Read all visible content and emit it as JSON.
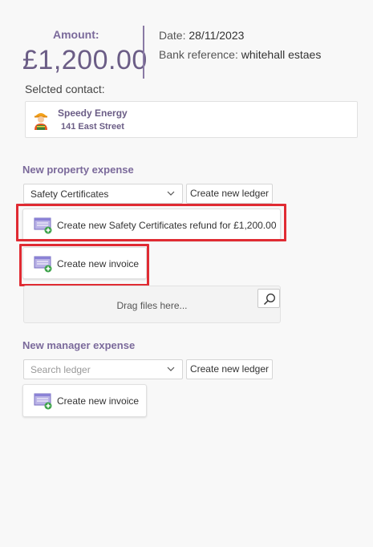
{
  "summary": {
    "amount_label": "Amount:",
    "amount_value": "£1,200.00",
    "date_label": "Date:",
    "date_value": "28/11/2023",
    "bank_ref_label": "Bank reference:",
    "bank_ref_value": "whitehall estaes"
  },
  "contact": {
    "selected_label": "Selcted contact:",
    "name": "Speedy Energy",
    "address": "141 East Street",
    "avatar_icon": "worker-avatar-icon"
  },
  "property_expense": {
    "title": "New property expense",
    "ledger_select_value": "Safety Certificates",
    "create_ledger_label": "Create new ledger",
    "refund_button_label": "Create new Safety Certificates refund for £1,200.00",
    "invoice_button_label": "Create new invoice",
    "dropzone_text": "Drag files here...",
    "dropzone_icon": "search-icon"
  },
  "manager_expense": {
    "title": "New manager expense",
    "ledger_placeholder": "Search ledger",
    "create_ledger_label": "Create new ledger",
    "invoice_button_label": "Create new invoice"
  },
  "colors": {
    "accent": "#7b6a9b",
    "highlight": "#e02b33",
    "add_badge": "#3ea34b"
  }
}
